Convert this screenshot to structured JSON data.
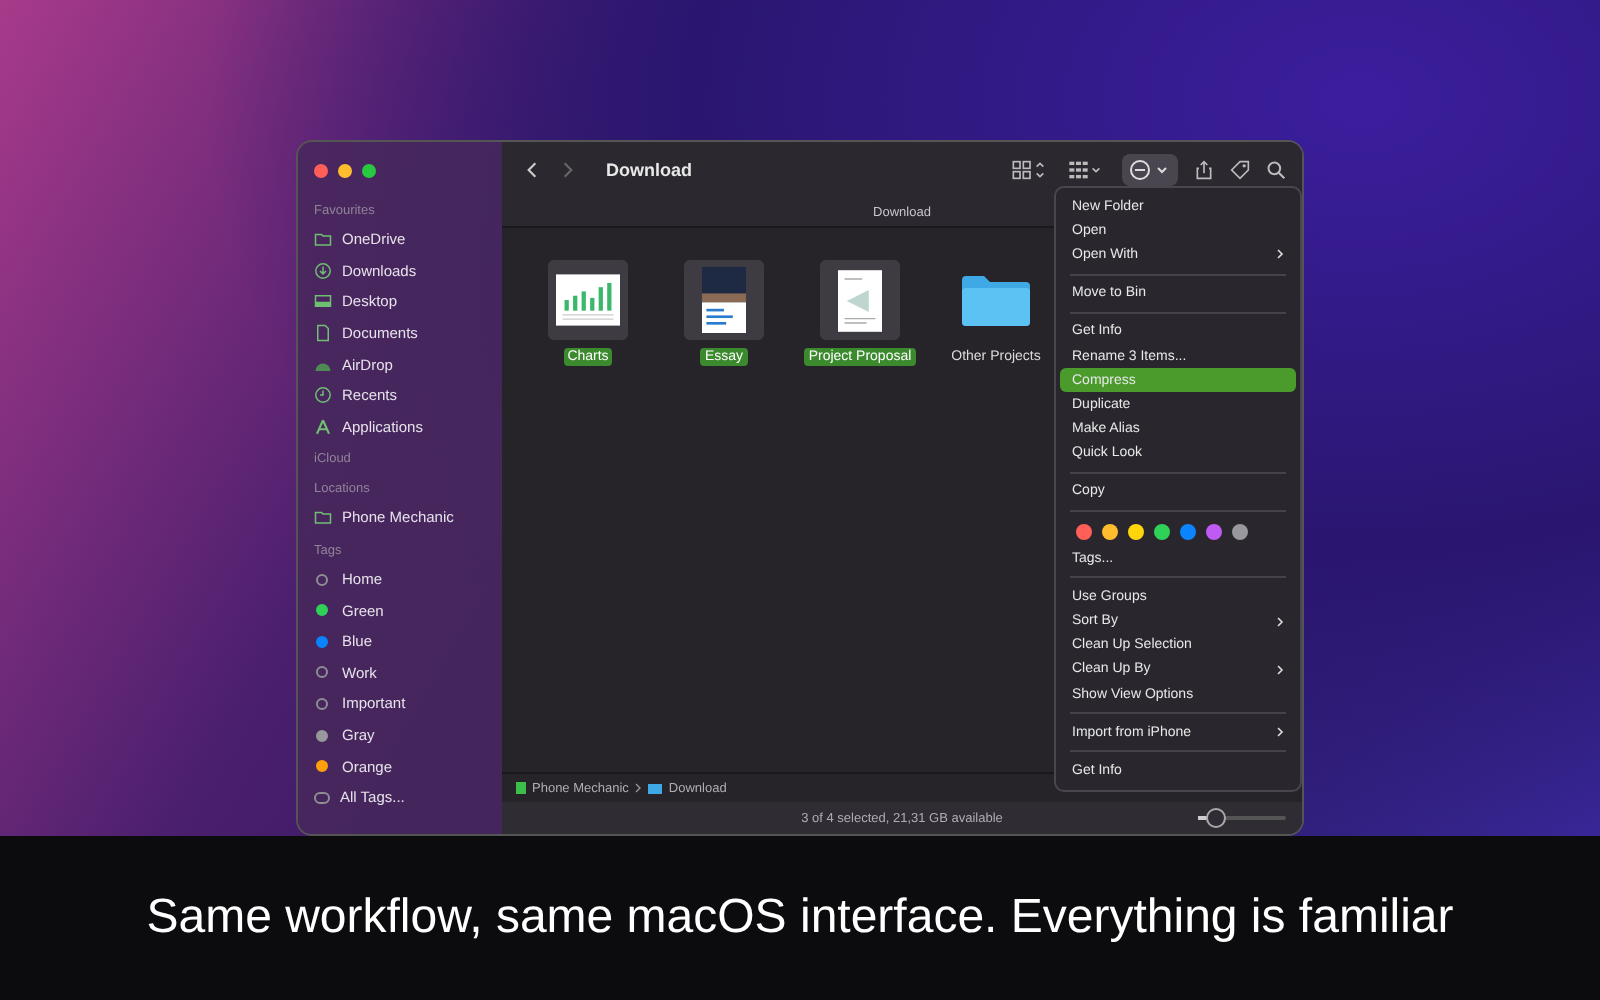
{
  "window": {
    "title": "Download",
    "path_header": "Download"
  },
  "sidebar": [
    {
      "heading": "Favourites",
      "items": [
        {
          "label": "OneDrive",
          "kind": "folder"
        },
        {
          "label": "Downloads",
          "kind": "download"
        },
        {
          "label": "Desktop",
          "kind": "desktop"
        },
        {
          "label": "Documents",
          "kind": "document"
        },
        {
          "label": "AirDrop",
          "kind": "airdrop"
        },
        {
          "label": "Recents",
          "kind": "clock"
        },
        {
          "label": "Applications",
          "kind": "apps"
        }
      ]
    },
    {
      "heading": "iCloud"
    },
    {
      "heading": "Locations",
      "items": [
        {
          "label": "Phone Mechanic",
          "kind": "folder"
        }
      ]
    }
  ],
  "tags": {
    "heading": "Tags",
    "items": [
      {
        "label": "Home",
        "filled": false,
        "color": "#8e8e93"
      },
      {
        "label": "Green",
        "filled": true,
        "color": "#30d158"
      },
      {
        "label": "Blue",
        "filled": true,
        "color": "#0a84ff"
      },
      {
        "label": "Work",
        "filled": false,
        "color": "#8e8e93"
      },
      {
        "label": "Important",
        "filled": false,
        "color": "#8e8e93"
      },
      {
        "label": "Gray",
        "filled": true,
        "color": "#98989d"
      },
      {
        "label": "Orange",
        "filled": true,
        "color": "#ff9f0a"
      },
      {
        "label": "All Tags...",
        "filled": false,
        "color": "#8e8e93",
        "kind": "all"
      }
    ]
  },
  "files": [
    {
      "name": "Charts",
      "kind": "chart",
      "selected": true
    },
    {
      "name": "Essay",
      "kind": "essay",
      "selected": true
    },
    {
      "name": "Project Proposal",
      "kind": "document",
      "selected": true
    },
    {
      "name": "Other Projects",
      "kind": "folder",
      "selected": false
    }
  ],
  "context_menu": [
    [
      {
        "label": "New Folder",
        "submenu": false,
        "selected": false
      },
      {
        "label": "Open",
        "submenu": false,
        "selected": false
      },
      {
        "label": "Open With",
        "submenu": true,
        "selected": false
      }
    ],
    [
      {
        "label": "Move to Bin",
        "submenu": false,
        "selected": false
      }
    ],
    [
      {
        "label": "Get Info",
        "submenu": false,
        "selected": false
      },
      {
        "label": "Rename 3 Items...",
        "submenu": false,
        "selected": false
      },
      {
        "label": "Compress",
        "submenu": false,
        "selected": true
      },
      {
        "label": "Duplicate",
        "submenu": false,
        "selected": false
      },
      {
        "label": "Make Alias",
        "submenu": false,
        "selected": false
      },
      {
        "label": "Quick Look",
        "submenu": false,
        "selected": false
      }
    ],
    [
      {
        "label": "Copy",
        "submenu": false,
        "selected": false
      }
    ],
    [
      {
        "kind": "colors",
        "colors": [
          {
            "color": "#ff5f57"
          },
          {
            "color": "#febc2e"
          },
          {
            "color": "#ffd60a"
          },
          {
            "color": "#30d158"
          },
          {
            "color": "#0a84ff"
          },
          {
            "color": "#bf5af2"
          },
          {
            "color": "#98989d"
          }
        ]
      },
      {
        "label": "Tags...",
        "submenu": false,
        "selected": false
      }
    ],
    [
      {
        "label": "Use Groups",
        "submenu": false,
        "selected": false
      },
      {
        "label": "Sort By",
        "submenu": true,
        "selected": false
      },
      {
        "label": "Clean Up Selection",
        "submenu": false,
        "selected": false
      },
      {
        "label": "Clean Up By",
        "submenu": true,
        "selected": false
      },
      {
        "label": "Show View Options",
        "submenu": false,
        "selected": false
      }
    ],
    [
      {
        "label": "Import from iPhone",
        "submenu": true,
        "selected": false
      }
    ],
    [
      {
        "label": "Get Info",
        "submenu": false,
        "selected": false
      }
    ]
  ],
  "path_bar": [
    {
      "label": "Phone Mechanic",
      "kind": "drive"
    },
    {
      "label": "Download",
      "kind": "folder"
    }
  ],
  "status_bar": {
    "text": "3 of 4 selected, 21,31 GB available",
    "zoom": {
      "level": 0.2
    }
  },
  "caption": "Same workflow, same macOS interface. Everything is familiar"
}
